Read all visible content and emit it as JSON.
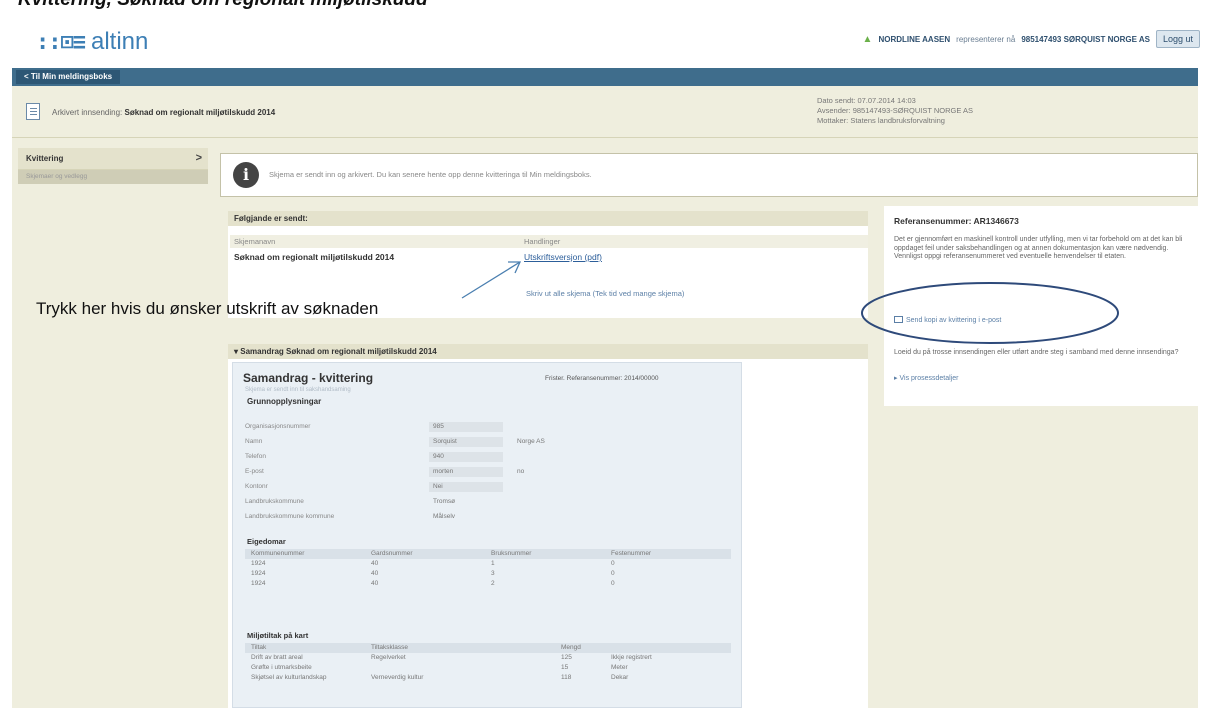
{
  "page_caption": "Kvittering, Søknad om regionalt miljøtilskudd",
  "header": {
    "logo_text": "altinn",
    "user_name": "NORDLINE AASEN",
    "represents": "representerer nå",
    "org": "985147493 SØRQUIST NORGE AS",
    "logout_label": "Logg ut"
  },
  "nav": {
    "back_label": "< Til Min meldingsboks"
  },
  "titlebar": {
    "archived_label": "Arkivert innsending:",
    "archived_title": "Søknad om regionalt miljøtilskudd 2014",
    "sent_line": "Dato sendt: 07.07.2014 14:03",
    "sender_line": "Avsender: 985147493-SØRQUIST NORGE AS",
    "receiver_line": "Mottaker: Statens landbruksforvaltning"
  },
  "sidebar": {
    "active_label": "Kvittering",
    "item_label": "Skjemaer og vedlegg"
  },
  "info": {
    "text": "Skjema er sendt inn og arkivert. Du kan senere hente opp denne kvitteringa til Min meldingsboks."
  },
  "sent": {
    "heading": "Følgjande er sendt:",
    "col_name": "Skjemanavn",
    "col_actions": "Handlinger",
    "form_name": "Søknad om regionalt miljøtilskudd 2014",
    "print_link": "Utskriftsversjon (pdf)",
    "print_all_link": "Skriv ut alle skjema (Tek tid ved mange skjema)"
  },
  "annotation": {
    "text": "Trykk her hvis du ønsker utskrift av søknaden"
  },
  "reference": {
    "title": "Referansenummer: AR1346673",
    "text": "Det er gjennomført en maskinell kontroll under utfylling, men vi tar forbehold om at det kan bli oppdaget feil under saksbehandlingen og at annen dokumentasjon kan være nødvendig. Vennligst oppgi referansenummeret ved eventuelle henvendelser til etaten.",
    "email_link": "Send kopi av kvittering i e-post",
    "note": "Loeid du på trosse innsendingen eller utført andre steg i samband med denne innsendinga?",
    "process_link": "Vis prosessdetaljer"
  },
  "summary": {
    "heading": "▾ Samandrag Søknad om regionalt miljøtilskudd 2014",
    "doc_title": "Samandrag - kvittering",
    "doc_ref": "Frister. Referansenummer: 2014/00000",
    "doc_sub": "Skjema er sendt inn til sakshandsaming",
    "group_title": "Grunnopplysningar",
    "fields": [
      {
        "label": "Organisasjonsnummer",
        "value": "985",
        "unit": ""
      },
      {
        "label": "Namn",
        "value": "Sorquist",
        "unit": "Norge AS"
      },
      {
        "label": "Telefon",
        "value": "940",
        "unit": ""
      },
      {
        "label": "E-post",
        "value": "morten",
        "unit": "no"
      },
      {
        "label": "Kontonr",
        "value": "Nei",
        "unit": ""
      },
      {
        "label": "Landbrukskommune",
        "value": "Tromsø",
        "unit": ""
      },
      {
        "label": "Landbrukskommune kommune",
        "value": "Målselv",
        "unit": ""
      }
    ],
    "props_title": "Eigedomar",
    "props_cols": [
      "Kommunenummer",
      "Gardsnummer",
      "Bruksnummer",
      "Festenummer"
    ],
    "props_rows": [
      [
        "1924",
        "40",
        "1",
        "0"
      ],
      [
        "1924",
        "40",
        "3",
        "0"
      ],
      [
        "1924",
        "40",
        "2",
        "0"
      ]
    ],
    "measures_title": "Miljøtiltak på kart",
    "measures_cols": [
      "Tiltak",
      "Tiltaksklasse",
      "Mengd",
      ""
    ],
    "measures_rows": [
      [
        "Drift av bratt areal",
        "Regelverket",
        "125",
        "Ikkje registrert"
      ],
      [
        "Grøfte i utmarksbeite",
        "",
        "15",
        "Meter"
      ],
      [
        "Skjøtsel av kulturlandskap",
        "Verneverdig kultur",
        "118",
        "Dekar"
      ]
    ]
  }
}
